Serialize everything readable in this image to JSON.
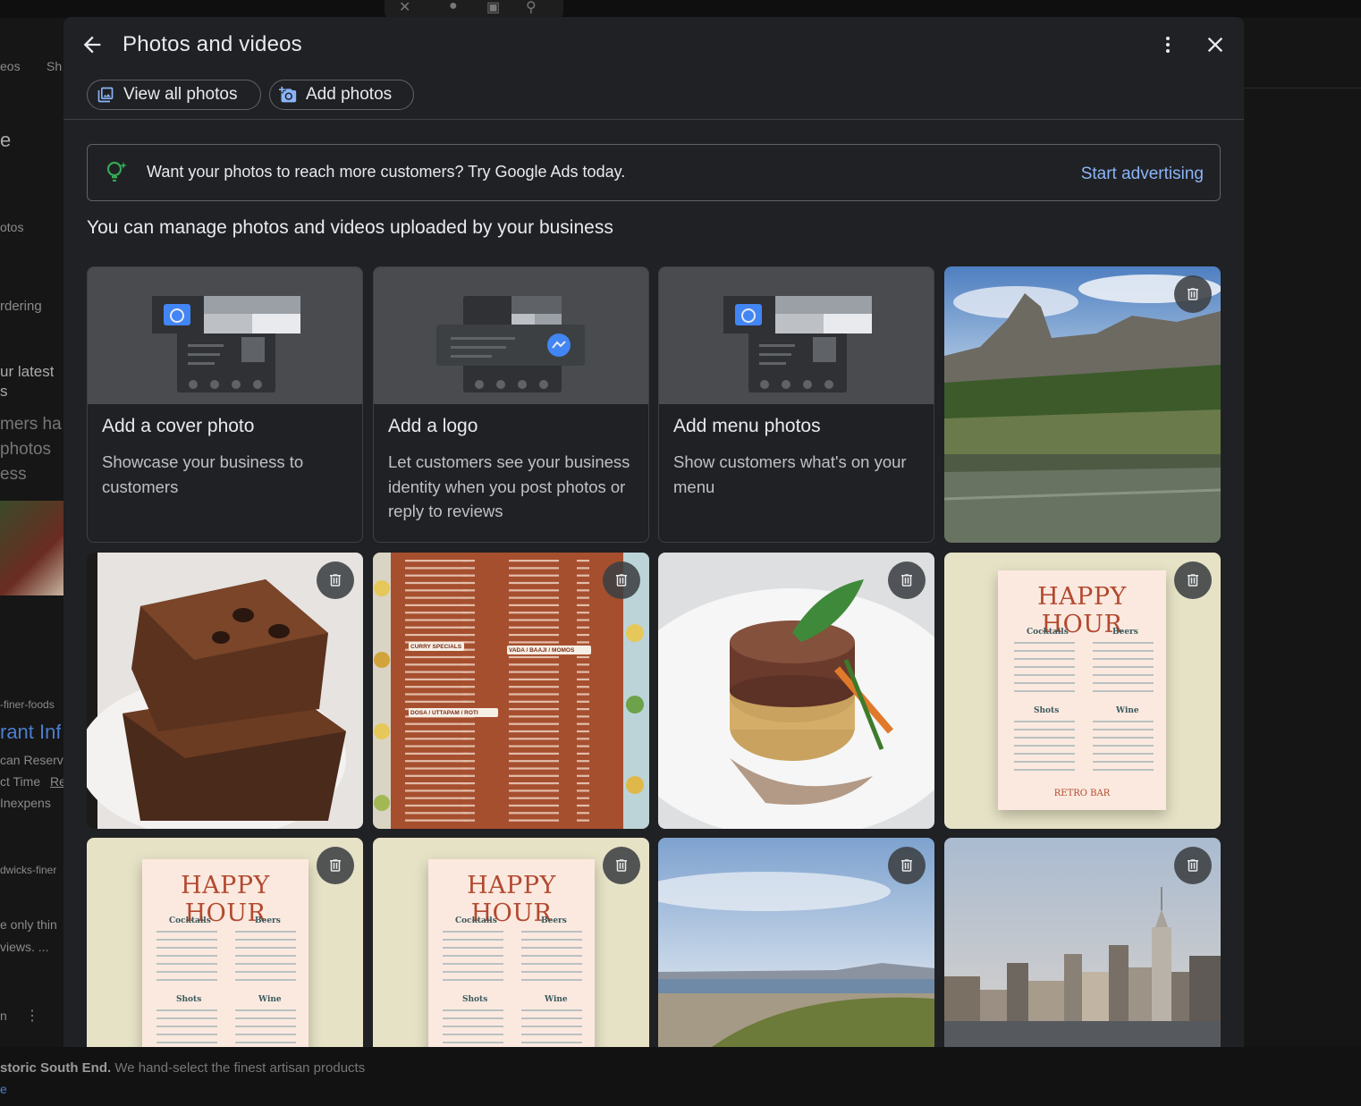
{
  "background": {
    "left_snippets": [
      "eos",
      "Sh",
      "e",
      "otos",
      "rdering",
      "ur latest",
      "s",
      "mers ha",
      " photos",
      "ess",
      "-finer-foods",
      "rant Inf",
      "can Reserv",
      "ct Time",
      "Re",
      " Inexpens",
      "dwicks-finer",
      "e only thin",
      "views.  ...",
      "n"
    ],
    "bottom_bold": "storic South End.",
    "bottom_rest": " We hand-select the finest artisan products",
    "bottom_line2": "e"
  },
  "dialog": {
    "title": "Photos and videos",
    "view_all_label": "View all photos",
    "add_photos_label": "Add photos",
    "promo_text": "Want your photos to reach more customers? Try Google Ads today.",
    "promo_link": "Start advertising",
    "subtitle": "You can manage photos and videos uploaded by your business"
  },
  "cards": [
    {
      "title": "Add a cover photo",
      "desc": "Showcase your business to customers"
    },
    {
      "title": "Add a logo",
      "desc": "Let customers see your business identity when you post photos or reply to reviews"
    },
    {
      "title": "Add menu photos",
      "desc": "Show customers what's on your menu"
    }
  ],
  "menu_poster": {
    "heading": "HAPPY HOUR",
    "cocktails": "Cocktails",
    "beers": "Beers",
    "shots": "Shots",
    "wine": "Wine",
    "footer": "RETRO BAR"
  },
  "menu_board": {
    "sections": [
      "CURRY SPECIALS",
      "VADA / BAAJI / MOMOS",
      "DOSA / UTTAPAM / ROTI"
    ]
  },
  "photos": [
    {
      "name": "mountain-meadow-photo"
    },
    {
      "name": "brownie-photo"
    },
    {
      "name": "indian-menu-board-photo"
    },
    {
      "name": "steak-dish-photo"
    },
    {
      "name": "happy-hour-menu-photo-1"
    },
    {
      "name": "happy-hour-menu-photo-2"
    },
    {
      "name": "happy-hour-menu-photo-3"
    },
    {
      "name": "beach-photo"
    },
    {
      "name": "city-skyline-photo"
    }
  ],
  "colors": {
    "dialog_bg": "#202124",
    "link": "#8ab4f8",
    "promo_icon": "#34a853",
    "accent_blue": "#4285f4"
  }
}
